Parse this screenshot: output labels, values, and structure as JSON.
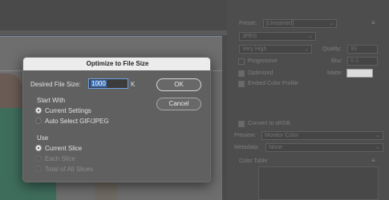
{
  "dialog": {
    "title": "Optimize to File Size",
    "desired_label": "Desired File Size:",
    "desired_value": "1000",
    "unit": "K",
    "ok_label": "OK",
    "cancel_label": "Cancel",
    "start_with": {
      "heading": "Start With",
      "options": [
        "Current Settings",
        "Auto Select GIF/JPEG"
      ],
      "selected": "Current Settings"
    },
    "use": {
      "heading": "Use",
      "options": [
        "Current Slice",
        "Each Slice",
        "Total of All Slices"
      ],
      "selected": "Current Slice"
    }
  },
  "panel": {
    "preset_label": "Preset:",
    "preset_value": "[Unnamed]",
    "format_value": "JPEG",
    "quality_mode": "Very High",
    "quality_label": "Quality:",
    "quality_value": "99",
    "progressive_label": "Progressive",
    "blur_label": "Blur:",
    "blur_value": "0.3",
    "optimized_label": "Optimized",
    "matte_label": "Matte:",
    "embed_profile_label": "Embed Color Profile",
    "convert_srgb_label": "Convert to sRGB",
    "preview_label": "Preview:",
    "preview_value": "Monitor Color",
    "metadata_label": "Metadata:",
    "metadata_value": "None",
    "color_table_label": "Color Table"
  },
  "colors": {
    "dialog_bg": "#606060",
    "title_bar": "#ececec",
    "selection": "#3d6fb4",
    "focus_ring": "#6fa3e6"
  }
}
